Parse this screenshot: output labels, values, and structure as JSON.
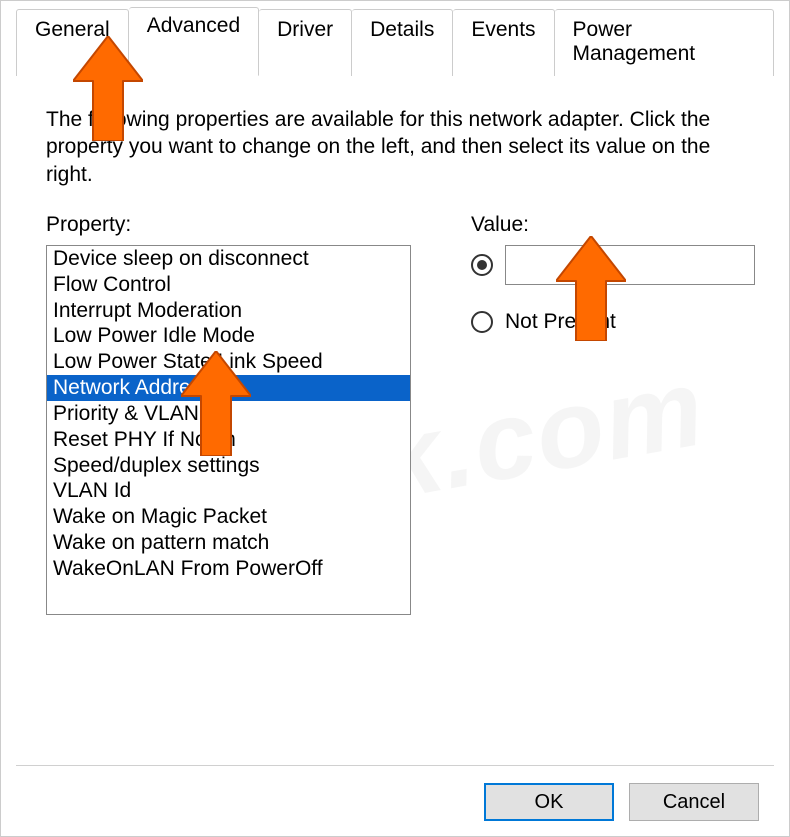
{
  "tabs": [
    {
      "label": "General"
    },
    {
      "label": "Advanced"
    },
    {
      "label": "Driver"
    },
    {
      "label": "Details"
    },
    {
      "label": "Events"
    },
    {
      "label": "Power Management"
    }
  ],
  "active_tab_index": 1,
  "description": "The following properties are available for this network adapter. Click the property you want to change on the left, and then select its value on the right.",
  "property_label": "Property:",
  "value_label": "Value:",
  "properties": [
    "Device sleep on disconnect",
    "Flow Control",
    "Interrupt Moderation",
    "Low Power Idle Mode",
    "Low Power State Link Speed",
    "Network Address",
    "Priority & VLAN",
    "Reset PHY If Not In",
    "Speed/duplex settings",
    "VLAN Id",
    "Wake on Magic Packet",
    "Wake on pattern match",
    "WakeOnLAN From PowerOff"
  ],
  "selected_property_index": 5,
  "value_radio": {
    "option_value": {
      "selected": true,
      "input_value": ""
    },
    "option_not_present": {
      "selected": false,
      "label": "Not Present"
    }
  },
  "buttons": {
    "ok": "OK",
    "cancel": "Cancel"
  },
  "watermark": "PCrisk.com"
}
